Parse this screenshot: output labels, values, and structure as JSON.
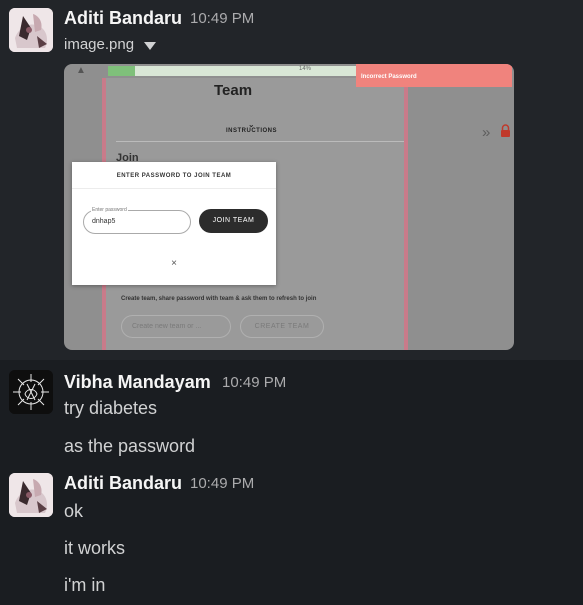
{
  "messages": [
    {
      "author": "Aditi Bandaru",
      "time": "10:49 PM",
      "avatar_icon": "cat-photo-avatar",
      "attachment": {
        "filename": "image.png",
        "screenshot": {
          "progress": "14%",
          "progress_fraction": 0.07,
          "title": "Team",
          "instructions_label": "INSTRUCTIONS",
          "join_label": "Join",
          "toast": "Incorrect Password",
          "modal": {
            "title": "ENTER PASSWORD TO JOIN TEAM",
            "field_label": "Enter password",
            "field_value": "dnhap5",
            "button": "JOIN TEAM",
            "close": "×"
          },
          "create_text": "Create team, share password with team & ask them to refresh to join",
          "create_placeholder": "Create new team or ...",
          "create_button": "CREATE TEAM"
        }
      }
    },
    {
      "author": "Vibha Mandayam",
      "time": "10:49 PM",
      "avatar_icon": "abstract-sketch-avatar",
      "lines": [
        "try diabetes",
        "as the password"
      ]
    },
    {
      "author": "Aditi Bandaru",
      "time": "10:49 PM",
      "avatar_icon": "cat-photo-avatar",
      "lines": [
        "ok",
        "it works",
        "i'm in"
      ]
    }
  ],
  "colors": {
    "background": "#1a1d21",
    "hover_background": "#222529",
    "toast": "#f0837d",
    "progress_fill": "#7fc07a"
  }
}
